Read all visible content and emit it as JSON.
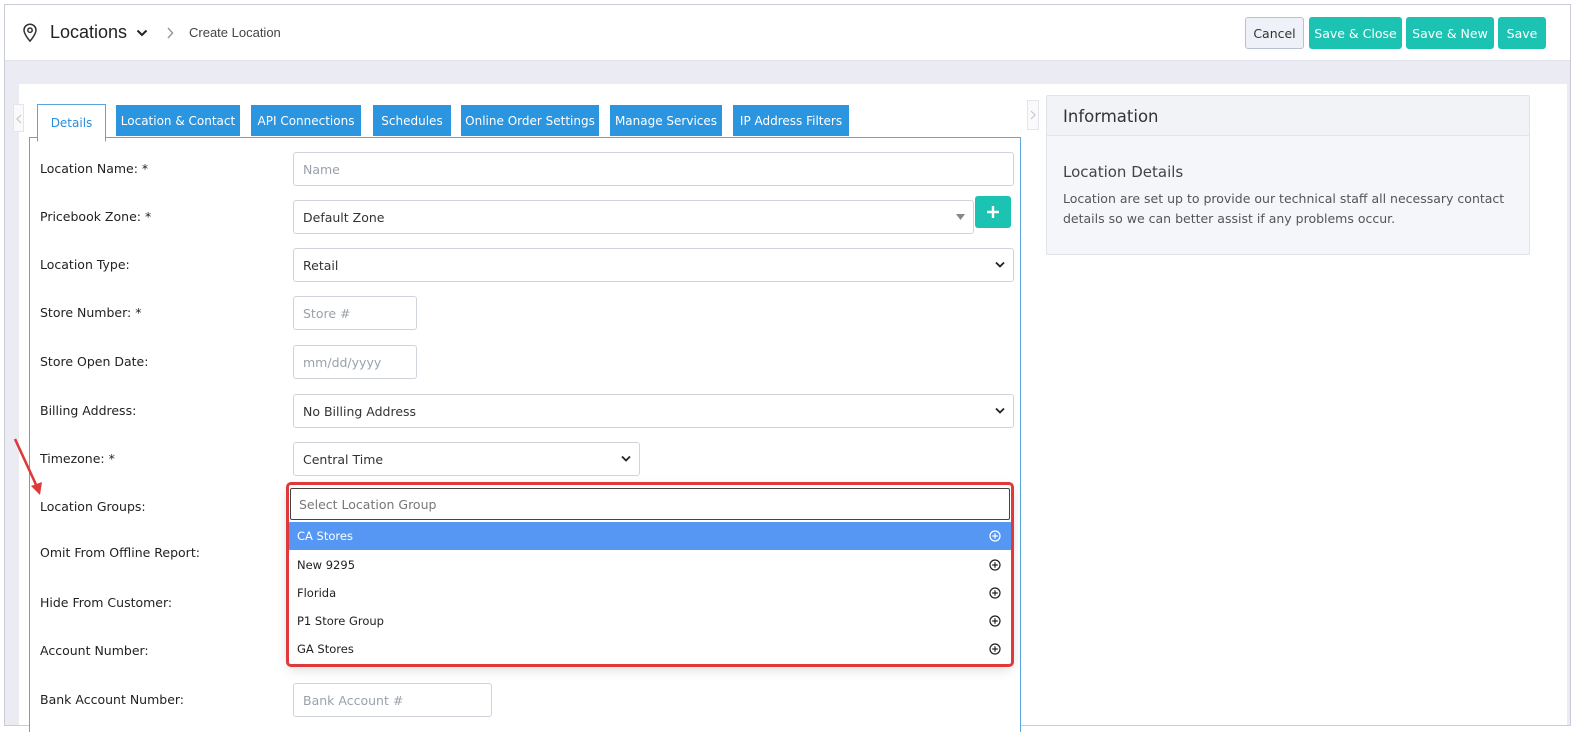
{
  "header": {
    "title": "Locations",
    "subtitle": "Create Location",
    "buttons": {
      "cancel": "Cancel",
      "save_close": "Save & Close",
      "save_new": "Save & New",
      "save": "Save"
    },
    "icons": [
      "location-pin-icon",
      "chevron-down-icon",
      "chevron-right-icon"
    ]
  },
  "tabs": [
    {
      "label": "Details",
      "active": true
    },
    {
      "label": "Location & Contact",
      "active": false
    },
    {
      "label": "API Connections",
      "active": false
    },
    {
      "label": "Schedules",
      "active": false
    },
    {
      "label": "Online Order Settings",
      "active": false
    },
    {
      "label": "Manage Services",
      "active": false
    },
    {
      "label": "IP Address Filters",
      "active": false
    }
  ],
  "form": {
    "location_name": {
      "label": "Location Name: *",
      "placeholder": "Name"
    },
    "pricebook_zone": {
      "label": "Pricebook Zone: *",
      "value": "Default Zone"
    },
    "location_type": {
      "label": "Location Type:",
      "value": "Retail"
    },
    "store_number": {
      "label": "Store Number: *",
      "placeholder": "Store #"
    },
    "store_open_date": {
      "label": "Store Open Date:",
      "placeholder": "mm/dd/yyyy"
    },
    "billing_address": {
      "label": "Billing Address:",
      "value": "No Billing Address"
    },
    "timezone": {
      "label": "Timezone: *",
      "value": "Central Time"
    },
    "location_groups": {
      "label": "Location Groups:",
      "placeholder": "Select Location Group",
      "options": [
        "CA Stores",
        "New 9295",
        "Florida",
        "P1 Store Group",
        "GA Stores"
      ],
      "highlighted_option": "CA Stores"
    },
    "omit_offline": {
      "label": "Omit From Offline Report:"
    },
    "hide_customer": {
      "label": "Hide From Customer:"
    },
    "account_number": {
      "label": "Account Number:"
    },
    "bank_account": {
      "label": "Bank Account Number:",
      "placeholder": "Bank Account #"
    }
  },
  "info": {
    "title": "Information",
    "subtitle": "Location Details",
    "text": "Location are set up to provide our technical staff all necessary contact details so we can better assist if any problems occur."
  },
  "colors": {
    "accent_teal": "#1cc3b2",
    "tab_blue": "#2b95e0",
    "highlight_blue": "#5697f4",
    "annotation_red": "#e0393c"
  }
}
